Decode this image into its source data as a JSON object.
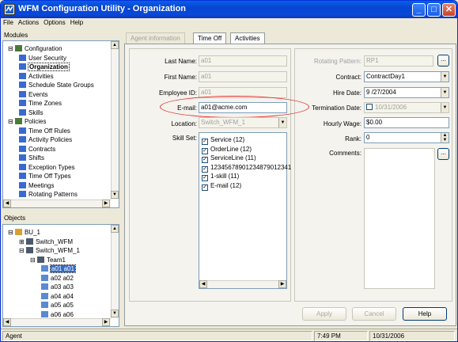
{
  "window": {
    "title": "WFM Configuration Utility - Organization",
    "min": "_",
    "max": "□",
    "close": "✕"
  },
  "menu": [
    "File",
    "Actions",
    "Options",
    "Help"
  ],
  "modules": {
    "header": "Modules",
    "items": [
      {
        "label": "Configuration",
        "level": 0,
        "expander": "⊟"
      },
      {
        "label": "User Security",
        "level": 1
      },
      {
        "label": "Organization",
        "level": 1,
        "selected": true
      },
      {
        "label": "Activities",
        "level": 1
      },
      {
        "label": "Schedule State Groups",
        "level": 1
      },
      {
        "label": "Events",
        "level": 1
      },
      {
        "label": "Time Zones",
        "level": 1
      },
      {
        "label": "Skills",
        "level": 1
      },
      {
        "label": "Policies",
        "level": 0,
        "expander": "⊟"
      },
      {
        "label": "Time Off Rules",
        "level": 1
      },
      {
        "label": "Activity Policies",
        "level": 1
      },
      {
        "label": "Contracts",
        "level": 1
      },
      {
        "label": "Shifts",
        "level": 1
      },
      {
        "label": "Exception Types",
        "level": 1
      },
      {
        "label": "Time Off Types",
        "level": 1
      },
      {
        "label": "Meetings",
        "level": 1
      },
      {
        "label": "Rotating Patterns",
        "level": 1
      }
    ]
  },
  "objects": {
    "header": "Objects",
    "items": [
      {
        "label": "BU_1",
        "level": 0,
        "expander": "⊟"
      },
      {
        "label": "Switch_WFM",
        "level": 1,
        "expander": "⊞"
      },
      {
        "label": "Switch_WFM_1",
        "level": 1,
        "expander": "⊟"
      },
      {
        "label": "Team1",
        "level": 2,
        "expander": "⊟"
      },
      {
        "label": "a01 a01",
        "level": 3,
        "selected": true
      },
      {
        "label": "a02 a02",
        "level": 3
      },
      {
        "label": "a03 a03",
        "level": 3
      },
      {
        "label": "a04 a04",
        "level": 3
      },
      {
        "label": "a05 a05",
        "level": 3
      },
      {
        "label": "a06 a06",
        "level": 3
      }
    ]
  },
  "tabs": [
    "Agent information",
    "Time Off",
    "Activities"
  ],
  "form": {
    "last_name": {
      "label": "Last Name:",
      "value": "a01"
    },
    "first_name": {
      "label": "First Name:",
      "value": "a01"
    },
    "employee_id": {
      "label": "Employee ID:",
      "value": "a01"
    },
    "email": {
      "label": "E-mail:",
      "value": "a01@acme.com"
    },
    "location": {
      "label": "Location:",
      "value": "Switch_WFM_1"
    },
    "skill_set": {
      "label": "Skill Set:",
      "items": [
        "Service (12)",
        "OrderLine (12)",
        "ServiceLine (11)",
        "12345678901234879012341",
        "1-skill (11)",
        "E-mail (12)"
      ]
    },
    "rotating_pattern": {
      "label": "Rotating Pattern:",
      "value": "RP1"
    },
    "contract": {
      "label": "Contract:",
      "value": "ContractDay1"
    },
    "hire_date": {
      "label": "Hire Date:",
      "value": "9 /27/2004"
    },
    "termination_date": {
      "label": "Termination Date:",
      "value": "10/31/2006"
    },
    "hourly_wage": {
      "label": "Hourly Wage:",
      "value": "$0.00"
    },
    "rank": {
      "label": "Rank:",
      "value": "0"
    },
    "comments": {
      "label": "Comments:"
    },
    "ellipsis": "..."
  },
  "buttons": {
    "apply": "Apply",
    "cancel": "Cancel",
    "help": "Help"
  },
  "status": {
    "left": "Agent",
    "time": "7:49 PM",
    "date": "10/31/2006"
  },
  "colors": {
    "highlight_ring": "#e03030",
    "selection": "#316ac5",
    "titlebar": "#0a5fe8"
  }
}
